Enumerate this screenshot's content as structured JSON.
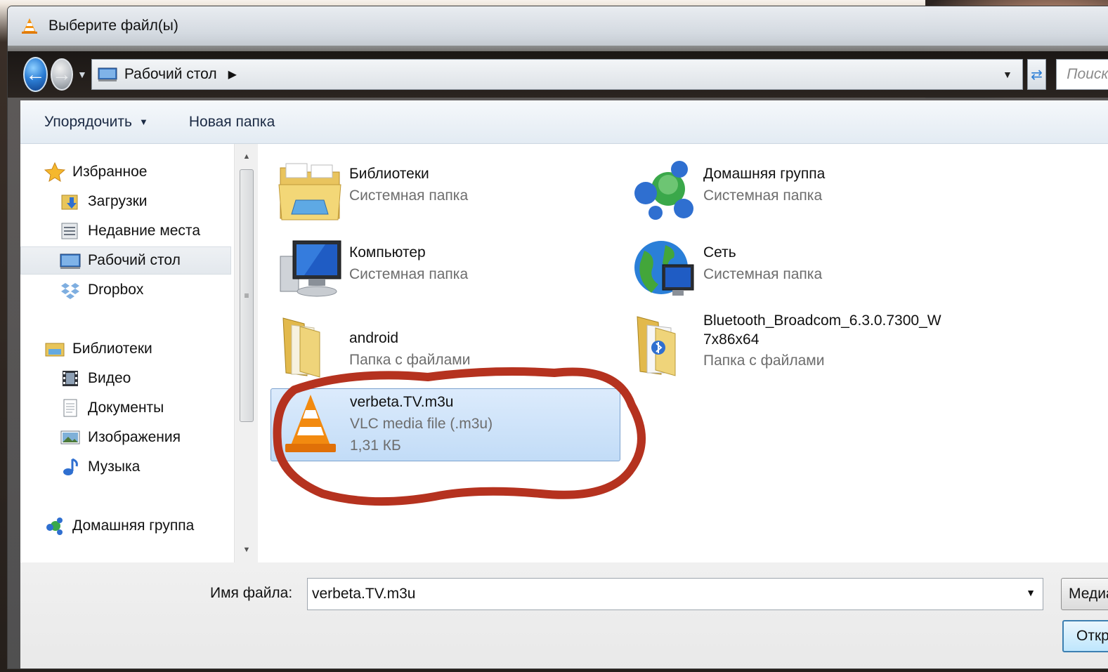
{
  "window": {
    "title": "Выберите файл(ы)"
  },
  "address": {
    "location": "Рабочий стол",
    "search_placeholder": "Поиск"
  },
  "toolbar": {
    "organize_label": "Упорядочить",
    "new_folder_label": "Новая папка"
  },
  "nav_tree": [
    {
      "label": "Избранное",
      "icon": "star-icon",
      "indent": 0
    },
    {
      "label": "Загрузки",
      "icon": "downloads-folder-icon",
      "indent": 1
    },
    {
      "label": "Недавние места",
      "icon": "recent-places-icon",
      "indent": 1
    },
    {
      "label": "Рабочий стол",
      "icon": "desktop-icon",
      "indent": 1,
      "selected": true
    },
    {
      "label": "Dropbox",
      "icon": "dropbox-icon",
      "indent": 1
    },
    {
      "label": "Библиотеки",
      "icon": "libraries-icon",
      "indent": 0
    },
    {
      "label": "Видео",
      "icon": "video-icon",
      "indent": 1
    },
    {
      "label": "Документы",
      "icon": "documents-icon",
      "indent": 1
    },
    {
      "label": "Изображения",
      "icon": "pictures-icon",
      "indent": 1
    },
    {
      "label": "Музыка",
      "icon": "music-icon",
      "indent": 1
    },
    {
      "label": "Домашняя группа",
      "icon": "homegroup-icon",
      "indent": 0
    }
  ],
  "files": [
    {
      "name": "Библиотеки",
      "lines": [
        "Системная папка"
      ],
      "icon": "libraries-folder-icon"
    },
    {
      "name": "Домашняя группа",
      "lines": [
        "Системная папка"
      ],
      "icon": "homegroup-icon"
    },
    {
      "name": "Компьютер",
      "lines": [
        "Системная папка"
      ],
      "icon": "computer-icon"
    },
    {
      "name": "Сеть",
      "lines": [
        "Системная папка"
      ],
      "icon": "network-icon"
    },
    {
      "name": "android",
      "lines": [
        "Папка с файлами"
      ],
      "icon": "folder-icon"
    },
    {
      "name": "Bluetooth_Broadcom_6.3.0.7300_W\n7x86x64",
      "lines": [
        "Папка с файлами"
      ],
      "icon": "folder-icon"
    },
    {
      "name": "verbeta.TV.m3u",
      "lines": [
        "VLC media file (.m3u)",
        "1,31 КБ"
      ],
      "icon": "vlc-cone-icon",
      "selected": true
    }
  ],
  "bottom": {
    "filename_label": "Имя файла:",
    "filename_value": "verbeta.TV.m3u",
    "filetype_label": "Медиафайлы",
    "open_label": "Открыть"
  },
  "colors": {
    "selection": "#c2dcf7",
    "selection_border": "#7da2ce",
    "annotation_ring": "#b5321f"
  }
}
